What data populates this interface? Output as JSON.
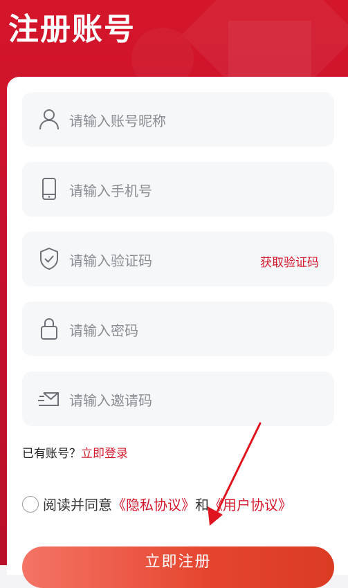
{
  "page": {
    "title": "注册账号"
  },
  "form": {
    "fields": [
      {
        "icon": "user-icon",
        "placeholder": "请输入账号昵称"
      },
      {
        "icon": "phone-icon",
        "placeholder": "请输入手机号"
      },
      {
        "icon": "shield-check-icon",
        "placeholder": "请输入验证码",
        "action": "获取验证码"
      },
      {
        "icon": "lock-icon",
        "placeholder": "请输入密码"
      },
      {
        "icon": "mail-icon",
        "placeholder": "请输入邀请码"
      }
    ],
    "login_prompt": "已有账号？",
    "login_link": "立即登录",
    "agree_prefix": "阅读并同意",
    "privacy_link": "《隐私协议》",
    "agree_and": "和",
    "user_link": "《用户协议》",
    "submit_label": "立即注册"
  },
  "annotation": {
    "icon": "arrow-icon",
    "color": "#e0141e"
  },
  "colors": {
    "brand": "#c8102e",
    "accent_text": "#d4182c"
  }
}
